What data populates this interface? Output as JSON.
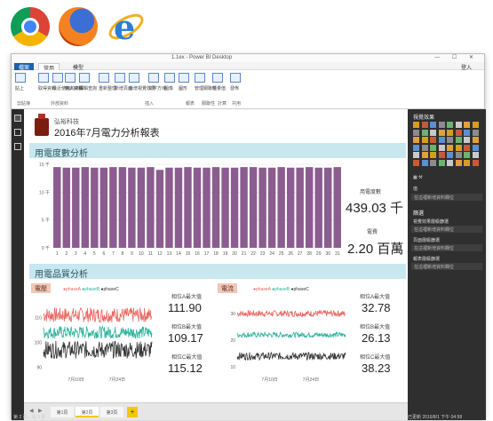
{
  "window": {
    "title": "1.1ex - Power BI Desktop",
    "controls": "— ☐ ✕"
  },
  "menu": {
    "tabs": [
      "檔案",
      "常用",
      "模型"
    ],
    "signin": "登入"
  },
  "ribbon": {
    "buttons": [
      {
        "label": "貼上"
      },
      {
        "label": "取得資料"
      },
      {
        "label": "最近使用的來源"
      },
      {
        "label": "輸入資料"
      },
      {
        "label": "編輯查詢"
      },
      {
        "label": "重新整理"
      },
      {
        "label": "新增頁面"
      },
      {
        "label": "新增視覺效果"
      },
      {
        "label": "文字方塊"
      },
      {
        "label": "圖像"
      },
      {
        "label": "圖形"
      },
      {
        "label": "管理關聯性"
      },
      {
        "label": "新量值"
      },
      {
        "label": "發佈"
      }
    ],
    "groups": [
      "剪貼簿",
      "外部資料",
      "插入",
      "報表",
      "關聯性",
      "計算",
      "共用"
    ]
  },
  "report": {
    "company": "弘裕科技",
    "title": "2016年7月電力分析報表",
    "section1": "用電度數分析",
    "section2": "用電品質分析"
  },
  "kpi": {
    "usage_label": "用電度數",
    "usage_value": "439.03 千",
    "cost_label": "電費",
    "cost_value": "2.20 百萬"
  },
  "quality": {
    "left": {
      "badge": "電壓",
      "legend": [
        "●phaseA",
        "●phaseB",
        "●phaseC"
      ],
      "items": [
        {
          "label": "相位A最大值",
          "value": "111.90"
        },
        {
          "label": "相位B最大值",
          "value": "109.17"
        },
        {
          "label": "相位C最大值",
          "value": "115.12"
        }
      ],
      "xticks": [
        "7月10日",
        "7月24日"
      ]
    },
    "right": {
      "badge": "電流",
      "legend": [
        "●phaseA",
        "●phaseB",
        "●phaseC"
      ],
      "items": [
        {
          "label": "相位A最大值",
          "value": "32.78"
        },
        {
          "label": "相位B最大值",
          "value": "26.13"
        },
        {
          "label": "相位C最大值",
          "value": "38.23"
        }
      ],
      "xticks": [
        "7月10日",
        "7月24日"
      ]
    }
  },
  "pages": {
    "tabs": [
      "第1頁",
      "第2頁",
      "第3頁"
    ],
    "add": "+",
    "prev": "◀",
    "next": "▶"
  },
  "right_pane": {
    "title": "視覺效果",
    "values_label": "值",
    "values_box": "在這裡新增資料欄位",
    "filters_title": "篩選",
    "filters": [
      "視覺效果層級篩選",
      "在這裡新增資料欄位",
      "頁面層級篩選",
      "在這裡新增資料欄位",
      "報表層級篩選",
      "在這裡新增資料欄位"
    ]
  },
  "status": {
    "left": "第 2 頁，共 3 頁",
    "right": "已更新 2016/8/1 下午 04:58"
  },
  "colors": {
    "bar": "#8b5c8f",
    "phaseA": "#e8665f",
    "phaseB": "#2bb39b",
    "phaseC": "#333333",
    "section_bg": "#c9e7ef",
    "badge_bg": "#f3c6b6"
  },
  "chart_data": [
    {
      "type": "bar",
      "title": "用電度數分析",
      "categories": [
        "1",
        "2",
        "3",
        "4",
        "5",
        "6",
        "7",
        "8",
        "9",
        "10",
        "11",
        "12",
        "13",
        "14",
        "15",
        "16",
        "17",
        "18",
        "19",
        "20",
        "21",
        "22",
        "23",
        "24",
        "25",
        "26",
        "27",
        "28",
        "29",
        "30",
        "31"
      ],
      "values": [
        14.5,
        14.4,
        14.4,
        14.5,
        14.4,
        14.4,
        14.5,
        14.5,
        14.4,
        14.4,
        14.5,
        14.0,
        14.4,
        14.4,
        14.5,
        14.4,
        14.4,
        14.5,
        14.4,
        14.4,
        14.5,
        14.5,
        14.4,
        14.4,
        14.5,
        14.4,
        14.4,
        14.5,
        14.4,
        14.4,
        14.5
      ],
      "yticks": [
        "0 千",
        "5 千",
        "10 千",
        "15 千"
      ],
      "ylim": [
        0,
        15
      ],
      "xlabel": "",
      "ylabel": ""
    },
    {
      "type": "line",
      "title": "電壓",
      "series": [
        {
          "name": "phaseA",
          "level": 111,
          "noise": 3
        },
        {
          "name": "phaseB",
          "level": 104,
          "noise": 2.5
        },
        {
          "name": "phaseC",
          "level": 97,
          "noise": 3.5
        }
      ],
      "yticks": [
        "110",
        "100",
        "90"
      ],
      "ylim": [
        88,
        118
      ]
    },
    {
      "type": "line",
      "title": "電流",
      "series": [
        {
          "name": "phaseA",
          "level": 30,
          "noise": 1.2
        },
        {
          "name": "phaseB",
          "level": 22,
          "noise": 1.0
        },
        {
          "name": "phaseC",
          "level": 14,
          "noise": 1.4
        }
      ],
      "yticks": [
        "30",
        "20",
        "10"
      ],
      "ylim": [
        8,
        36
      ]
    }
  ]
}
